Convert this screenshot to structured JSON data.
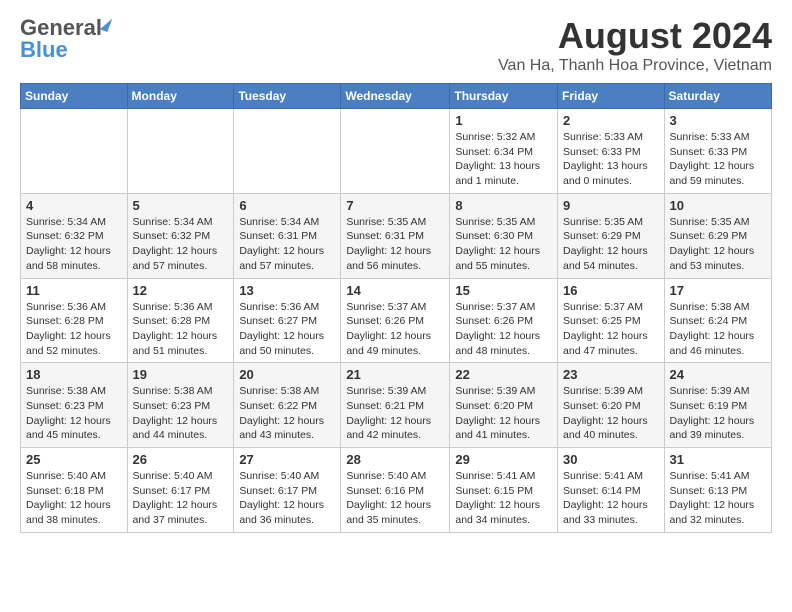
{
  "logo": {
    "line1": "General",
    "line2": "Blue"
  },
  "title": "August 2024",
  "subtitle": "Van Ha, Thanh Hoa Province, Vietnam",
  "headers": [
    "Sunday",
    "Monday",
    "Tuesday",
    "Wednesday",
    "Thursday",
    "Friday",
    "Saturday"
  ],
  "weeks": [
    [
      {
        "day": "",
        "info": ""
      },
      {
        "day": "",
        "info": ""
      },
      {
        "day": "",
        "info": ""
      },
      {
        "day": "",
        "info": ""
      },
      {
        "day": "1",
        "info": "Sunrise: 5:32 AM\nSunset: 6:34 PM\nDaylight: 13 hours and 1 minute."
      },
      {
        "day": "2",
        "info": "Sunrise: 5:33 AM\nSunset: 6:33 PM\nDaylight: 13 hours and 0 minutes."
      },
      {
        "day": "3",
        "info": "Sunrise: 5:33 AM\nSunset: 6:33 PM\nDaylight: 12 hours and 59 minutes."
      }
    ],
    [
      {
        "day": "4",
        "info": "Sunrise: 5:34 AM\nSunset: 6:32 PM\nDaylight: 12 hours and 58 minutes."
      },
      {
        "day": "5",
        "info": "Sunrise: 5:34 AM\nSunset: 6:32 PM\nDaylight: 12 hours and 57 minutes."
      },
      {
        "day": "6",
        "info": "Sunrise: 5:34 AM\nSunset: 6:31 PM\nDaylight: 12 hours and 57 minutes."
      },
      {
        "day": "7",
        "info": "Sunrise: 5:35 AM\nSunset: 6:31 PM\nDaylight: 12 hours and 56 minutes."
      },
      {
        "day": "8",
        "info": "Sunrise: 5:35 AM\nSunset: 6:30 PM\nDaylight: 12 hours and 55 minutes."
      },
      {
        "day": "9",
        "info": "Sunrise: 5:35 AM\nSunset: 6:29 PM\nDaylight: 12 hours and 54 minutes."
      },
      {
        "day": "10",
        "info": "Sunrise: 5:35 AM\nSunset: 6:29 PM\nDaylight: 12 hours and 53 minutes."
      }
    ],
    [
      {
        "day": "11",
        "info": "Sunrise: 5:36 AM\nSunset: 6:28 PM\nDaylight: 12 hours and 52 minutes."
      },
      {
        "day": "12",
        "info": "Sunrise: 5:36 AM\nSunset: 6:28 PM\nDaylight: 12 hours and 51 minutes."
      },
      {
        "day": "13",
        "info": "Sunrise: 5:36 AM\nSunset: 6:27 PM\nDaylight: 12 hours and 50 minutes."
      },
      {
        "day": "14",
        "info": "Sunrise: 5:37 AM\nSunset: 6:26 PM\nDaylight: 12 hours and 49 minutes."
      },
      {
        "day": "15",
        "info": "Sunrise: 5:37 AM\nSunset: 6:26 PM\nDaylight: 12 hours and 48 minutes."
      },
      {
        "day": "16",
        "info": "Sunrise: 5:37 AM\nSunset: 6:25 PM\nDaylight: 12 hours and 47 minutes."
      },
      {
        "day": "17",
        "info": "Sunrise: 5:38 AM\nSunset: 6:24 PM\nDaylight: 12 hours and 46 minutes."
      }
    ],
    [
      {
        "day": "18",
        "info": "Sunrise: 5:38 AM\nSunset: 6:23 PM\nDaylight: 12 hours and 45 minutes."
      },
      {
        "day": "19",
        "info": "Sunrise: 5:38 AM\nSunset: 6:23 PM\nDaylight: 12 hours and 44 minutes."
      },
      {
        "day": "20",
        "info": "Sunrise: 5:38 AM\nSunset: 6:22 PM\nDaylight: 12 hours and 43 minutes."
      },
      {
        "day": "21",
        "info": "Sunrise: 5:39 AM\nSunset: 6:21 PM\nDaylight: 12 hours and 42 minutes."
      },
      {
        "day": "22",
        "info": "Sunrise: 5:39 AM\nSunset: 6:20 PM\nDaylight: 12 hours and 41 minutes."
      },
      {
        "day": "23",
        "info": "Sunrise: 5:39 AM\nSunset: 6:20 PM\nDaylight: 12 hours and 40 minutes."
      },
      {
        "day": "24",
        "info": "Sunrise: 5:39 AM\nSunset: 6:19 PM\nDaylight: 12 hours and 39 minutes."
      }
    ],
    [
      {
        "day": "25",
        "info": "Sunrise: 5:40 AM\nSunset: 6:18 PM\nDaylight: 12 hours and 38 minutes."
      },
      {
        "day": "26",
        "info": "Sunrise: 5:40 AM\nSunset: 6:17 PM\nDaylight: 12 hours and 37 minutes."
      },
      {
        "day": "27",
        "info": "Sunrise: 5:40 AM\nSunset: 6:17 PM\nDaylight: 12 hours and 36 minutes."
      },
      {
        "day": "28",
        "info": "Sunrise: 5:40 AM\nSunset: 6:16 PM\nDaylight: 12 hours and 35 minutes."
      },
      {
        "day": "29",
        "info": "Sunrise: 5:41 AM\nSunset: 6:15 PM\nDaylight: 12 hours and 34 minutes."
      },
      {
        "day": "30",
        "info": "Sunrise: 5:41 AM\nSunset: 6:14 PM\nDaylight: 12 hours and 33 minutes."
      },
      {
        "day": "31",
        "info": "Sunrise: 5:41 AM\nSunset: 6:13 PM\nDaylight: 12 hours and 32 minutes."
      }
    ]
  ]
}
